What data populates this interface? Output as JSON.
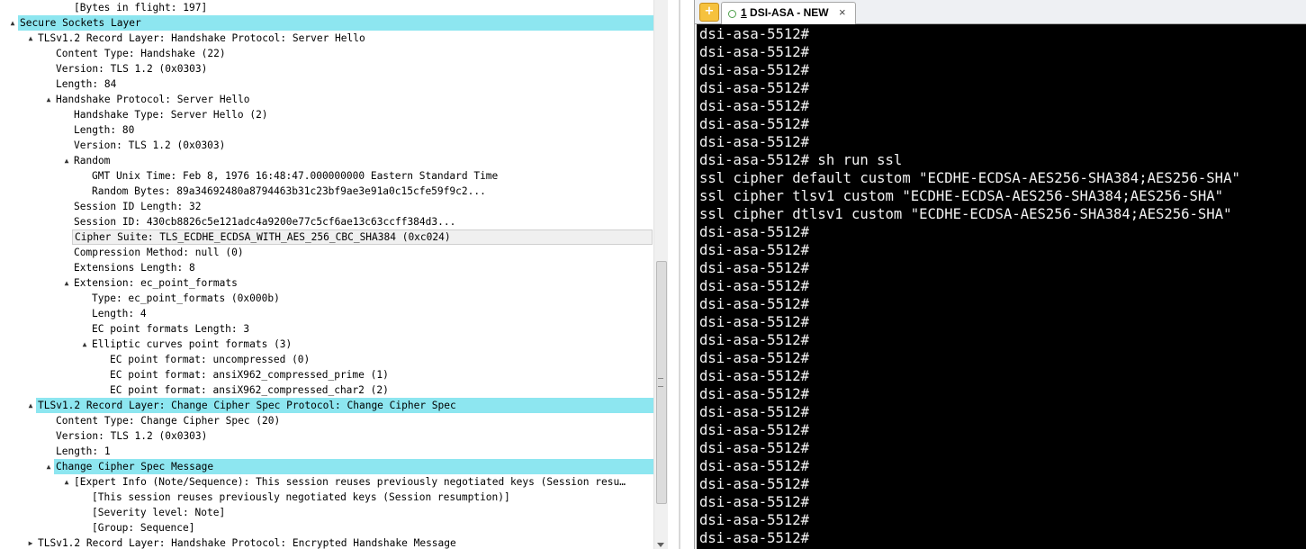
{
  "packet_tree": {
    "rows": [
      {
        "text": "[Bytes in flight: 197]",
        "indent": 3,
        "expander": "",
        "style": ""
      },
      {
        "text": "Secure Sockets Layer",
        "indent": 0,
        "expander": "▲",
        "style": "hl"
      },
      {
        "text": "TLSv1.2 Record Layer: Handshake Protocol: Server Hello",
        "indent": 1,
        "expander": "▲",
        "style": ""
      },
      {
        "text": "Content Type: Handshake (22)",
        "indent": 2,
        "expander": "",
        "style": ""
      },
      {
        "text": "Version: TLS 1.2 (0x0303)",
        "indent": 2,
        "expander": "",
        "style": ""
      },
      {
        "text": "Length: 84",
        "indent": 2,
        "expander": "",
        "style": ""
      },
      {
        "text": "Handshake Protocol: Server Hello",
        "indent": 2,
        "expander": "▲",
        "style": ""
      },
      {
        "text": "Handshake Type: Server Hello (2)",
        "indent": 3,
        "expander": "",
        "style": ""
      },
      {
        "text": "Length: 80",
        "indent": 3,
        "expander": "",
        "style": ""
      },
      {
        "text": "Version: TLS 1.2 (0x0303)",
        "indent": 3,
        "expander": "",
        "style": ""
      },
      {
        "text": "Random",
        "indent": 3,
        "expander": "▲",
        "style": ""
      },
      {
        "text": "GMT Unix Time: Feb  8, 1976 16:48:47.000000000 Eastern Standard Time",
        "indent": 4,
        "expander": "",
        "style": ""
      },
      {
        "text": "Random Bytes: 89a34692480a8794463b31c23bf9ae3e91a0c15cfe59f9c2...",
        "indent": 4,
        "expander": "",
        "style": ""
      },
      {
        "text": "Session ID Length: 32",
        "indent": 3,
        "expander": "",
        "style": ""
      },
      {
        "text": "Session ID: 430cb8826c5e121adc4a9200e77c5cf6ae13c63ccff384d3...",
        "indent": 3,
        "expander": "",
        "style": ""
      },
      {
        "text": "Cipher Suite: TLS_ECDHE_ECDSA_WITH_AES_256_CBC_SHA384 (0xc024)",
        "indent": 3,
        "expander": "",
        "style": "sel"
      },
      {
        "text": "Compression Method: null (0)",
        "indent": 3,
        "expander": "",
        "style": ""
      },
      {
        "text": "Extensions Length: 8",
        "indent": 3,
        "expander": "",
        "style": ""
      },
      {
        "text": "Extension: ec_point_formats",
        "indent": 3,
        "expander": "▲",
        "style": ""
      },
      {
        "text": "Type: ec_point_formats (0x000b)",
        "indent": 4,
        "expander": "",
        "style": ""
      },
      {
        "text": "Length: 4",
        "indent": 4,
        "expander": "",
        "style": ""
      },
      {
        "text": "EC point formats Length: 3",
        "indent": 4,
        "expander": "",
        "style": ""
      },
      {
        "text": "Elliptic curves point formats (3)",
        "indent": 4,
        "expander": "▲",
        "style": ""
      },
      {
        "text": "EC point format: uncompressed (0)",
        "indent": 5,
        "expander": "",
        "style": ""
      },
      {
        "text": "EC point format: ansiX962_compressed_prime (1)",
        "indent": 5,
        "expander": "",
        "style": ""
      },
      {
        "text": "EC point format: ansiX962_compressed_char2 (2)",
        "indent": 5,
        "expander": "",
        "style": ""
      },
      {
        "text": "TLSv1.2 Record Layer: Change Cipher Spec Protocol: Change Cipher Spec",
        "indent": 1,
        "expander": "▲",
        "style": "hl"
      },
      {
        "text": "Content Type: Change Cipher Spec (20)",
        "indent": 2,
        "expander": "",
        "style": ""
      },
      {
        "text": "Version: TLS 1.2 (0x0303)",
        "indent": 2,
        "expander": "",
        "style": ""
      },
      {
        "text": "Length: 1",
        "indent": 2,
        "expander": "",
        "style": ""
      },
      {
        "text": "Change Cipher Spec Message",
        "indent": 2,
        "expander": "▲",
        "style": "hl"
      },
      {
        "text": "[Expert Info (Note/Sequence): This session reuses previously negotiated keys (Session resu…",
        "indent": 3,
        "expander": "▲",
        "style": ""
      },
      {
        "text": "[This session reuses previously negotiated keys (Session resumption)]",
        "indent": 4,
        "expander": "",
        "style": ""
      },
      {
        "text": "[Severity level: Note]",
        "indent": 4,
        "expander": "",
        "style": ""
      },
      {
        "text": "[Group: Sequence]",
        "indent": 4,
        "expander": "",
        "style": ""
      },
      {
        "text": "TLSv1.2 Record Layer: Handshake Protocol: Encrypted Handshake Message",
        "indent": 1,
        "expander": "▶",
        "style": ""
      }
    ]
  },
  "terminal": {
    "new_tab_label": "+",
    "tab_number": "1",
    "tab_title": "DSI-ASA - NEW",
    "tab_close": "×",
    "lines": [
      "dsi-asa-5512#",
      "dsi-asa-5512#",
      "dsi-asa-5512#",
      "dsi-asa-5512#",
      "dsi-asa-5512#",
      "dsi-asa-5512#",
      "dsi-asa-5512#",
      "dsi-asa-5512# sh run ssl",
      "ssl cipher default custom \"ECDHE-ECDSA-AES256-SHA384;AES256-SHA\"",
      "ssl cipher tlsv1 custom \"ECDHE-ECDSA-AES256-SHA384;AES256-SHA\"",
      "ssl cipher dtlsv1 custom \"ECDHE-ECDSA-AES256-SHA384;AES256-SHA\"",
      "dsi-asa-5512#",
      "dsi-asa-5512#",
      "dsi-asa-5512#",
      "dsi-asa-5512#",
      "dsi-asa-5512#",
      "dsi-asa-5512#",
      "dsi-asa-5512#",
      "dsi-asa-5512#",
      "dsi-asa-5512#",
      "dsi-asa-5512#",
      "dsi-asa-5512#",
      "dsi-asa-5512#",
      "dsi-asa-5512#",
      "dsi-asa-5512#",
      "dsi-asa-5512#",
      "dsi-asa-5512#",
      "dsi-asa-5512#",
      "dsi-asa-5512#",
      "dsi-asa-5512# "
    ]
  },
  "colors": {
    "highlight": "#8de6f0",
    "terminal_bg": "#000000",
    "terminal_fg": "#f2f2f2",
    "cursor": "#32d232"
  }
}
